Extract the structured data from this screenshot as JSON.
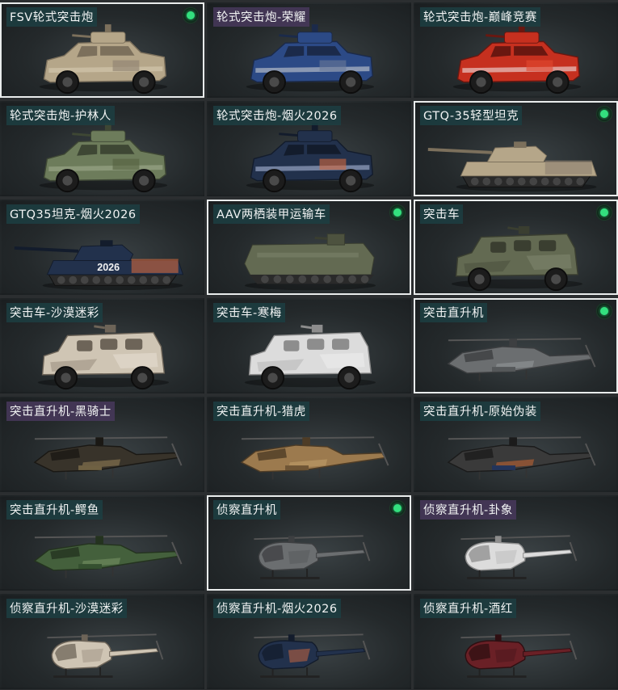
{
  "tiles": [
    {
      "label": "FSV轮式突击炮",
      "type": "wheeled",
      "camo": "sand",
      "selected": true,
      "owned": true,
      "rare": false
    },
    {
      "label": "轮式突击炮-荣耀",
      "type": "wheeled",
      "camo": "glory",
      "selected": false,
      "owned": false,
      "rare": true
    },
    {
      "label": "轮式突击炮-巅峰竞赛",
      "type": "wheeled",
      "camo": "red",
      "selected": false,
      "owned": false,
      "rare": false
    },
    {
      "label": "轮式突击炮-护林人",
      "type": "wheeled",
      "camo": "forest",
      "selected": false,
      "owned": false,
      "rare": false
    },
    {
      "label": "轮式突击炮-烟火2026",
      "type": "wheeled",
      "camo": "firework",
      "selected": false,
      "owned": false,
      "rare": false
    },
    {
      "label": "GTQ-35轻型坦克",
      "type": "tank",
      "camo": "sand",
      "selected": true,
      "owned": true,
      "rare": false
    },
    {
      "label": "GTQ35坦克-烟火2026",
      "type": "tank",
      "camo": "firework",
      "selected": false,
      "owned": false,
      "rare": false
    },
    {
      "label": "AAV两栖装甲运输车",
      "type": "aav",
      "camo": "olive",
      "selected": true,
      "owned": true,
      "rare": false
    },
    {
      "label": "突击车",
      "type": "mrap",
      "camo": "olive",
      "selected": true,
      "owned": true,
      "rare": false
    },
    {
      "label": "突击车-沙漠迷彩",
      "type": "mrap",
      "camo": "desert",
      "selected": false,
      "owned": false,
      "rare": false
    },
    {
      "label": "突击车-寒梅",
      "type": "mrap",
      "camo": "white",
      "selected": false,
      "owned": false,
      "rare": false
    },
    {
      "label": "突击直升机",
      "type": "attack-heli",
      "camo": "grey",
      "selected": true,
      "owned": true,
      "rare": false
    },
    {
      "label": "突击直升机-黑骑士",
      "type": "attack-heli",
      "camo": "blackgold",
      "selected": false,
      "owned": false,
      "rare": true
    },
    {
      "label": "突击直升机-猎虎",
      "type": "attack-heli",
      "camo": "tiger",
      "selected": false,
      "owned": false,
      "rare": false
    },
    {
      "label": "突击直升机-原始伪装",
      "type": "attack-heli",
      "camo": "primal",
      "selected": false,
      "owned": false,
      "rare": false
    },
    {
      "label": "突击直升机-鳄鱼",
      "type": "attack-heli",
      "camo": "croc",
      "selected": false,
      "owned": false,
      "rare": false
    },
    {
      "label": "侦察直升机",
      "type": "scout-heli",
      "camo": "grey",
      "selected": true,
      "owned": true,
      "rare": false
    },
    {
      "label": "侦察直升机-卦象",
      "type": "scout-heli",
      "camo": "white",
      "selected": false,
      "owned": false,
      "rare": true
    },
    {
      "label": "侦察直升机-沙漠迷彩",
      "type": "scout-heli",
      "camo": "desert",
      "selected": false,
      "owned": false,
      "rare": false
    },
    {
      "label": "侦察直升机-烟火2026",
      "type": "scout-heli",
      "camo": "firework",
      "selected": false,
      "owned": false,
      "rare": false
    },
    {
      "label": "侦察直升机-酒红",
      "type": "scout-heli",
      "camo": "wine",
      "selected": false,
      "owned": false,
      "rare": false
    }
  ],
  "colors": {
    "selected_border": "#e9ecec",
    "owned_dot": "#33e07e",
    "label_bg": "#1c3e42",
    "rare_label_bg": "#48385c"
  },
  "icons": {
    "owned": "owned-indicator-icon"
  }
}
